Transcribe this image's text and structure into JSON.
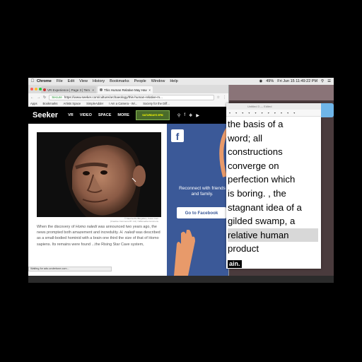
{
  "menubar": {
    "app": "Chrome",
    "items": [
      "File",
      "Edit",
      "View",
      "History",
      "Bookmarks",
      "People",
      "Window",
      "Help"
    ],
    "battery": "49%",
    "datetime": "Fri Jun 15  11:49:22 PM"
  },
  "tabs": [
    {
      "label": "VR Experience | Page 3 | Tem",
      "active": false
    },
    {
      "label": "This Human Relative May Hav",
      "active": true
    }
  ],
  "address": {
    "secure_label": "Secure",
    "url": "https://www.seeker.com/culture/archaeology/this-human-relative-m..."
  },
  "bookmarks": [
    "Apps",
    "Bookmarks",
    "Artists Space",
    "SimpleAdder",
    "I Am a Camera - Wi...",
    "Society for the Diff..."
  ],
  "site": {
    "logo": "Seeker",
    "nav": [
      "VR",
      "VIDEO",
      "SPACE",
      "MORE"
    ],
    "promo": "SATURDAYS 9PM"
  },
  "article": {
    "caption_line1": "© MaartenDe/Biogallery, Karen Carr",
    "caption_line2": "(Creative Commons BY 4.0) / Wikimedia Commons",
    "p1_a": "When the discovery of ",
    "p1_b": "Homo naledi",
    "p1_c": " was announced two years ago, the news prompted both amazement and incredulity. ",
    "p1_d": "H. naledi",
    "p1_e": " was described as a small-bodied hominid with a brain one third the size of that of Homo sapiens. Its remains were found",
    "p1_f": " ...the Rising Star Cave system,"
  },
  "status": "Waiting for ads.undertone.com...",
  "fbad": {
    "logo": "f",
    "text_line1": "Reconnect with friends",
    "text_line2": "and family.",
    "button": "Go to Facebook"
  },
  "editor": {
    "title": "Untitled 3 — Edited",
    "lines": [
      "the basis of a",
      "word; all",
      "constructions",
      "converge on",
      "perfection which",
      "is boring. , the",
      "stagnant idea of a",
      "gilded swamp, a",
      "relative human",
      "product"
    ],
    "last": "ain."
  },
  "colors": {
    "facebook": "#3b5998",
    "seeker_nav": "#000000",
    "highlight": "#d8d8d8"
  }
}
